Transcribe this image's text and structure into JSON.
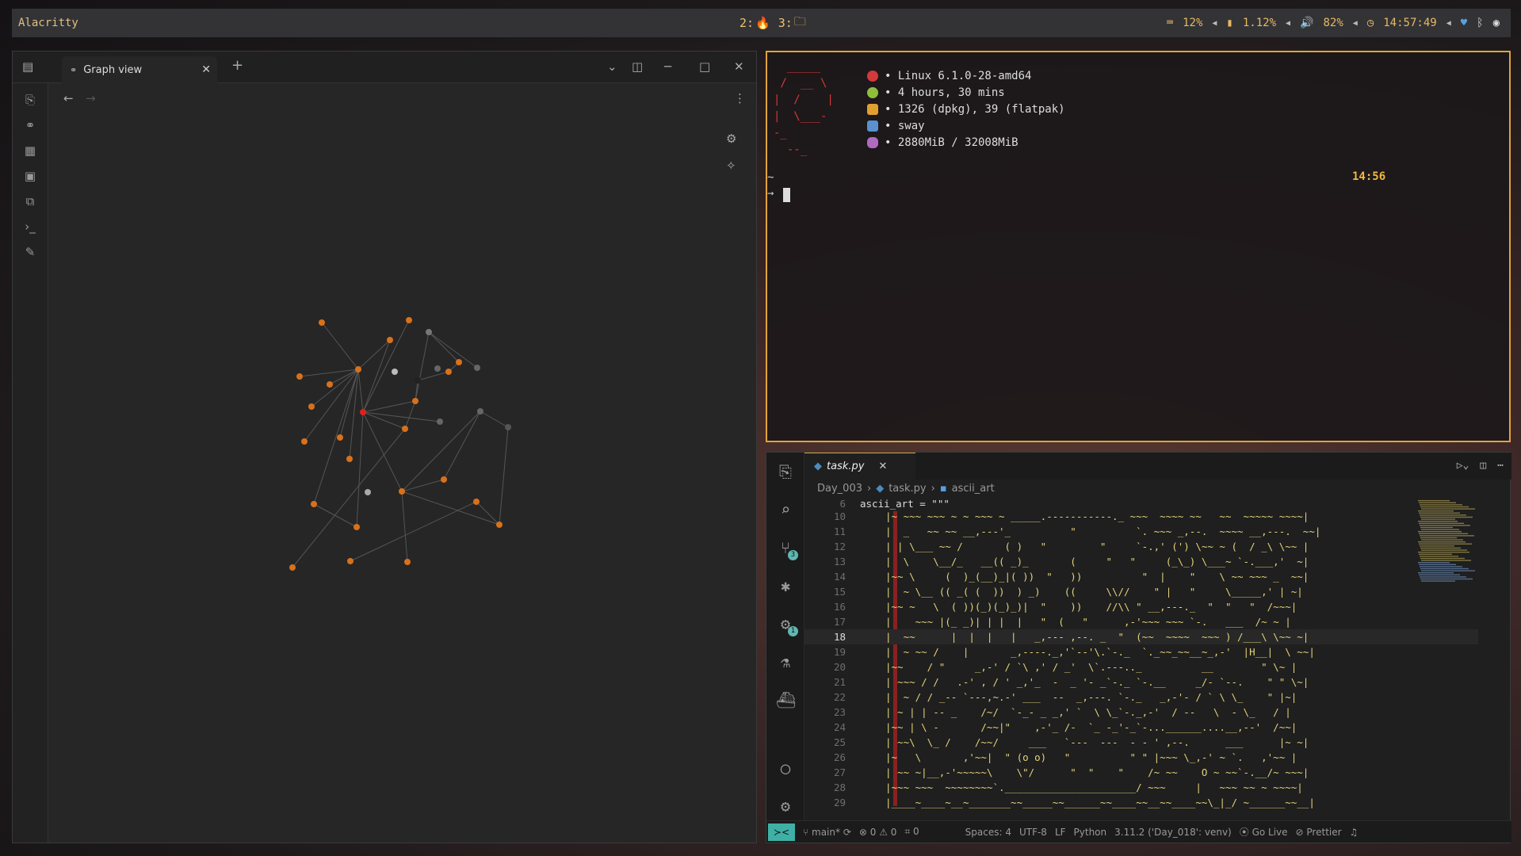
{
  "topbar": {
    "title": "Alacritty",
    "workspaces": [
      {
        "label": "2:",
        "icon": "firefox-icon"
      },
      {
        "label": "3:",
        "icon": "folder-icon"
      }
    ],
    "status": {
      "keyboard": "12%",
      "battery_or_disk": "1.12%",
      "volume": "82%",
      "clock": "14:57:49"
    }
  },
  "obsidian": {
    "tab_title": "Graph view",
    "nodes_orange": "#d9711a",
    "node_active": "#e0201e"
  },
  "terminal": {
    "ascii_logo": "  _____\n /  __ \\\n|  /    |\n|  \\___-\n-_\n  --_",
    "fetch": [
      {
        "icon": "linux-icon",
        "color": "#d43a3a",
        "text": "• Linux 6.1.0-28-amd64"
      },
      {
        "icon": "clock-icon",
        "color": "#8fbf3a",
        "text": "• 4 hours, 30 mins"
      },
      {
        "icon": "package-icon",
        "color": "#e0a030",
        "text": "• 1326 (dpkg), 39 (flatpak)"
      },
      {
        "icon": "window-icon",
        "color": "#5a8fd0",
        "text": "• sway"
      },
      {
        "icon": "database-icon",
        "color": "#b06ac0",
        "text": "• 2880MiB / 32008MiB"
      }
    ],
    "clock": "14:56",
    "prompt_char": "~",
    "prompt_arrow": "→"
  },
  "vscode": {
    "tab_label": "task.py",
    "breadcrumb": [
      "Day_003",
      "task.py",
      "ascii_art"
    ],
    "first_line": {
      "num": "6",
      "text": "ascii_art = \"\"\""
    },
    "active_line": "18",
    "lines": [
      {
        "num": "10",
        "text": "|~ ~~~ ~~~ ~ ~ ~~~ ~ _____.-----------._ ~~~  ~~~~ ~~   ~~  ~~~~~ ~~~~|"
      },
      {
        "num": "11",
        "text": "|  _   ~~ ~~ __,---'_          \"          `. ~~~ _,--.  ~~~~ __,---.  ~~|"
      },
      {
        "num": "12",
        "text": "| | \\___ ~~ /       ( )   \"         \"     `-.,' (') \\~~ ~ (  / _\\ \\~~ |"
      },
      {
        "num": "13",
        "text": "|  \\    \\__/_   __(( _)_       (     \"   \"     (_\\_) \\___~ `-.___,'  ~|"
      },
      {
        "num": "14",
        "text": "|~~ \\     (  )_(__)_|( ))  \"   ))          \"  |    \"    \\ ~~ ~~~ _  ~~|"
      },
      {
        "num": "15",
        "text": "|  ~ \\__ (( _( (  ))  ) _)    ((     \\\\//    \" |   \"     \\_____,' | ~|"
      },
      {
        "num": "16",
        "text": "|~~ ~   \\  ( ))(_)(_)_)|  \"    ))    //\\\\ \" __,---._  \"  \"   \"  /~~~|"
      },
      {
        "num": "17",
        "text": "|    ~~~ |(_ _)| | |  |   \"  (   \"      ,-'~~~ ~~~ `-.   ___  /~ ~ |"
      },
      {
        "num": "18",
        "text": "|  ~~      |  |  |   |   _,--- ,--. _  \"  (~~  ~~~~  ~~~ ) /___\\ \\~~ ~|"
      },
      {
        "num": "19",
        "text": "|  ~ ~~ /    |       _,----._,'`--'\\.`-._  `._~~_~~__~_,-'  |H__|  \\ ~~|"
      },
      {
        "num": "20",
        "text": "|~~    / \"     _,-' / `\\ ,' / _'  \\`.---.._          __        \" \\~ |"
      },
      {
        "num": "21",
        "text": "| ~~~ / /   .-' , / ' _,'_  -  _ '- _`-._ `-.__     _/- `--.    \" \" \\~|"
      },
      {
        "num": "22",
        "text": "|  ~ / / _-- `---,~.-' ___  --  _,---. `-._   _,-'- / ` \\ \\_    \" |~|"
      },
      {
        "num": "23",
        "text": "| ~ | | -- _    /~/  `-_- _ _,' `  \\ \\_`-._,-'  / --   \\  - \\_   / |"
      },
      {
        "num": "24",
        "text": "|~~ | \\ -       /~~|\"    ,-'_ /-  `_ -_'-_`-...______....__,--'  /~~|"
      },
      {
        "num": "25",
        "text": "| ~~\\  \\_ /    /~~/     ___   `---  ---  - - ' ,--.      ___      |~ ~|"
      },
      {
        "num": "26",
        "text": "|~   \\       ,'~~|  \" (o o)   \"          \" \" |~~~ \\_,-' ~ `.   ,'~~ |"
      },
      {
        "num": "27",
        "text": "| ~~ ~|__,-'~~~~~\\    \\\"/      \"  \"    \"    /~ ~~    O ~ ~~`-.__/~ ~~~|"
      },
      {
        "num": "28",
        "text": "|~~~ ~~~  ~~~~~~~~`.______________________/ ~~~     |   ~~~ ~~ ~ ~~~~|"
      },
      {
        "num": "29",
        "text": "|____~____~__~_______~~_____~~______~~____~~__~~____~~\\_|_/ ~______~~__|"
      }
    ],
    "status": {
      "branch": "main*",
      "errors": "0",
      "warnings": "0",
      "ports": "0",
      "spaces": "Spaces: 4",
      "encoding": "UTF-8",
      "eol": "LF",
      "language": "Python",
      "interpreter": "3.11.2 ('Day_018': venv)",
      "golive": "Go Live",
      "prettier": "Prettier"
    }
  }
}
